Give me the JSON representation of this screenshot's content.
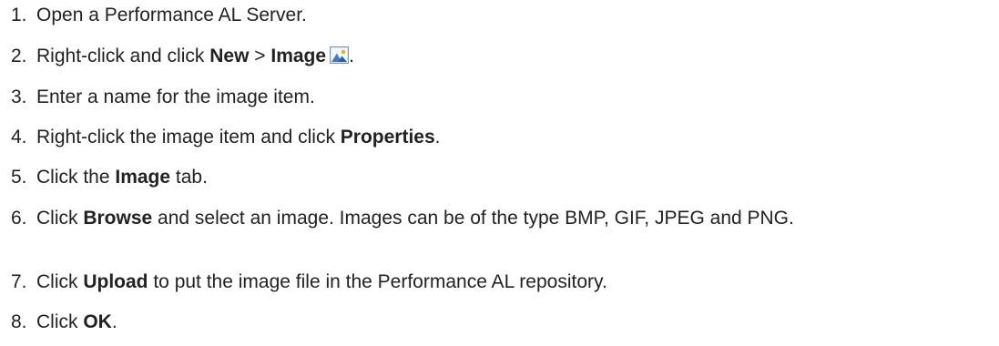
{
  "steps": [
    {
      "num": "1.",
      "text": "Open a Performance AL Server."
    },
    {
      "num": "2.",
      "pre": "Right-click and click ",
      "b1": "New",
      "mid": " > ",
      "b2": "Image",
      "post": "."
    },
    {
      "num": "3.",
      "text": "Enter a name for the image item."
    },
    {
      "num": "4.",
      "pre": "Right-click the image item and click ",
      "b1": "Properties",
      "post": "."
    },
    {
      "num": "5.",
      "pre": "Click the ",
      "b1": "Image",
      "post": " tab."
    },
    {
      "num": "6.",
      "pre": "Click ",
      "b1": "Browse",
      "post": " and select an image. Images can be of the type BMP, GIF, JPEG and PNG."
    },
    {
      "num": "7.",
      "pre": "Click ",
      "b1": "Upload",
      "post": " to put the image file in the Performance AL repository."
    },
    {
      "num": "8.",
      "pre": "Click ",
      "b1": "OK",
      "post": "."
    }
  ],
  "icons": {
    "image_icon": "image-icon"
  }
}
